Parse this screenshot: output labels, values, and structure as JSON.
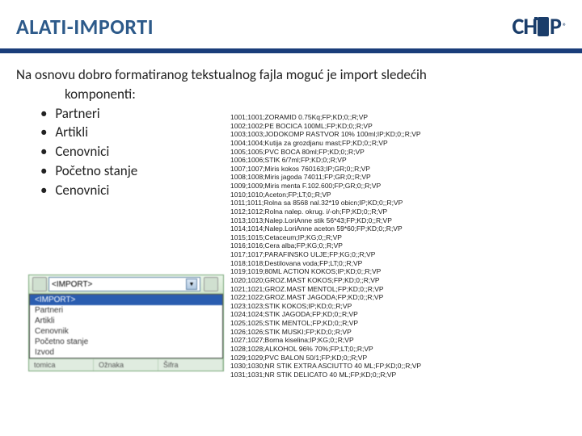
{
  "header": {
    "title": "ALATI-IMPORTI",
    "logo_prefix": "CH",
    "logo_suffix": "P",
    "logo_reg": "®"
  },
  "content": {
    "intro_line1": "Na osnovu dobro formatiranog tekstualnog fajla moguć je import sledećih",
    "intro_line2": "komponenti:",
    "bullets": [
      "Partneri",
      "Artikli",
      "Cenovnici",
      "Početno stanje",
      "Cenovnici"
    ]
  },
  "dropdown": {
    "selected": "<IMPORT>",
    "options": [
      "<IMPORT>",
      "Partneri",
      "Artikli",
      "Cenovnik",
      "Početno stanje",
      "Izvod"
    ],
    "footer": [
      "Ožnaka",
      "Šifra"
    ],
    "footer_prefix": "tomica"
  },
  "datafile_lines": [
    "1001;1001;ZORAMID 0.75Kq;FP;KD;0;;R;VP",
    "1002;1002;PE BOCICA 100ML;FP;KD;0;;R;VP",
    "1003;1003;JODOKOMP RASTVOR 10% 100ml;IP;KD;0;;R;VP",
    "1004;1004;Kutija za grozdjanu mast;FP;KD;0;;R;VP",
    "1005;1005;PVC BOCA 80ml;FP;KD;0;;R;VP",
    "1006;1006;STIK 6/7ml;FP;KD;0;;R;VP",
    "1007;1007;Miris kokos 760163;IP;GR;0;;R;VP",
    "1008;1008;Miris jagoda 74011;FP;GR;0;;R;VP",
    "1009;1009;Miris menta F.102.600;FP;GR;0;;R;VP",
    "1010;1010;Aceton;FP;LT;0;;R;VP",
    "1011;1011;Rolna sa 8568 nal.32*19 obicn;IP;KD;0;;R;VP",
    "1012;1012;Rolna nalep. okrug. i/-oh;FP;KD;0;;R;VP",
    "1013;1013;Nalep.LoriAnne stik 56*43;FP;KD;0;;R;VP",
    "1014;1014;Nalep.LoriAnne aceton 59*60;FP;KD;0;;R;VP",
    "1015;1015;Cetaceum;IP;KG;0;;R;VP",
    "1016;1016;Cera alba;FP;KG;0;;R;VP",
    "1017;1017;PARAFINSKO ULJE;FP;KG;0;;R;VP",
    "1018;1018;Destilovana voda;FP;LT;0;;R;VP",
    "1019;1019;80ML ACTION KOKOS;IP;KD;0;;R;VP",
    "1020;1020;GROZ.MAST KOKOS;FP;KD;0;;R;VP",
    "1021;1021;GROZ.MAST MENTOL;FP;KD;0;;R;VP",
    "1022;1022;GROZ.MAST JAGODA;FP;KD;0;;R;VP",
    "1023;1023;STIK KOKOS;IP;KD;0;;R;VP",
    "1024;1024;STIK JAGODA;FP;KD;0;;R;VP",
    "1025;1025;STIK MENTOL;FP;KD;0;;R;VP",
    "1026;1026;STIK MUSKI;FP;KD;0;;R;VP",
    "1027;1027;Borna kiselina;IP;KG;0;;R;VP",
    "1028;1028;ALKOHOL 96% 70%;FP;LT;0;;R;VP",
    "1029;1029;PVC BALON 50/1;FP;KD;0;;R;VP",
    "1030;1030;NR STIK EXTRA ASCIUTTO 40 ML;FP;KD;0;;R;VP",
    "1031;1031;NR STIK DELICATO 40 ML;FP;KD;0;;R;VP"
  ]
}
